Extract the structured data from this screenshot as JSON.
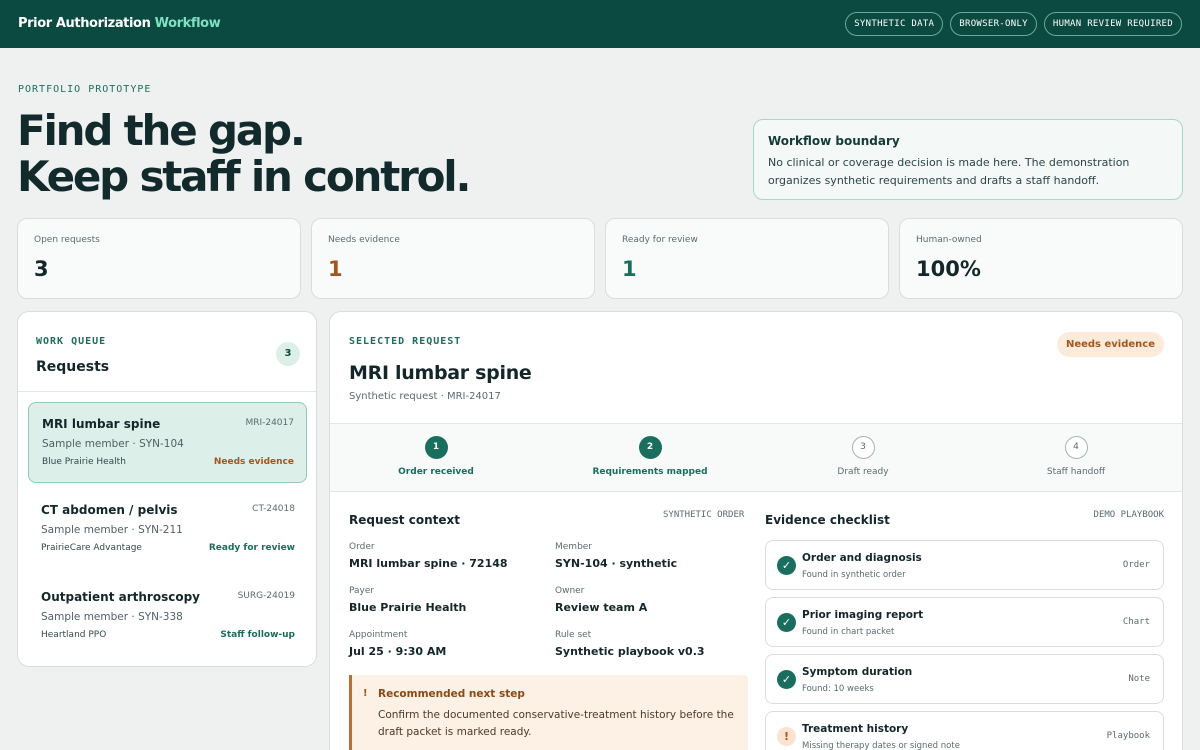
{
  "header": {
    "brand_main": "Prior Authorization",
    "brand_accent": "Workflow",
    "pills": [
      "SYNTHETIC DATA",
      "BROWSER-ONLY",
      "HUMAN REVIEW REQUIRED"
    ]
  },
  "hero": {
    "eyebrow": "PORTFOLIO PROTOTYPE",
    "title_line1": "Find the gap.",
    "title_line2": "Keep staff in control.",
    "boundary_title": "Workflow boundary",
    "boundary_body": "No clinical or coverage decision is made here. The demonstration organizes synthetic requirements and drafts a staff handoff."
  },
  "stats": [
    {
      "label": "Open requests",
      "value": "3",
      "color": "#14262a"
    },
    {
      "label": "Needs evidence",
      "value": "1",
      "color": "#a3561c"
    },
    {
      "label": "Ready for review",
      "value": "1",
      "color": "#1a6e5d"
    },
    {
      "label": "Human-owned",
      "value": "100%",
      "color": "#14262a"
    }
  ],
  "queue": {
    "eyebrow": "WORK QUEUE",
    "title": "Requests",
    "count": "3",
    "items": [
      {
        "title": "MRI lumbar spine",
        "id": "MRI-24017",
        "member": "Sample member · SYN-104",
        "payer": "Blue Prairie Health",
        "status": "Needs evidence",
        "status_color": "#a3561c",
        "active": true
      },
      {
        "title": "CT abdomen / pelvis",
        "id": "CT-24018",
        "member": "Sample member · SYN-211",
        "payer": "PrairieCare Advantage",
        "status": "Ready for review",
        "status_color": "#1a6e5d",
        "active": false
      },
      {
        "title": "Outpatient arthroscopy",
        "id": "SURG-24019",
        "member": "Sample member · SYN-338",
        "payer": "Heartland PPO",
        "status": "Staff follow-up",
        "status_color": "#1a6e5d",
        "active": false
      }
    ]
  },
  "detail": {
    "eyebrow": "SELECTED REQUEST",
    "title": "MRI lumbar spine",
    "subtitle": "Synthetic request · MRI-24017",
    "badge": "Needs evidence",
    "steps": [
      {
        "num": "1",
        "label": "Order received",
        "done": true
      },
      {
        "num": "2",
        "label": "Requirements mapped",
        "done": true
      },
      {
        "num": "3",
        "label": "Draft ready",
        "done": false
      },
      {
        "num": "4",
        "label": "Staff handoff",
        "done": false
      }
    ],
    "context": {
      "title": "Request context",
      "tag": "SYNTHETIC ORDER",
      "fields": [
        {
          "label": "Order",
          "value": "MRI lumbar spine · 72148"
        },
        {
          "label": "Member",
          "value": "SYN-104 · synthetic"
        },
        {
          "label": "Payer",
          "value": "Blue Prairie Health"
        },
        {
          "label": "Owner",
          "value": "Review team A"
        },
        {
          "label": "Appointment",
          "value": "Jul 25 · 9:30 AM"
        },
        {
          "label": "Rule set",
          "value": "Synthetic playbook v0.3"
        }
      ]
    },
    "next_step": {
      "icon": "!",
      "title": "Recommended next step",
      "body": "Confirm the documented conservative-treatment history before the draft packet is marked ready."
    },
    "evidence": {
      "title": "Evidence checklist",
      "tag": "DEMO PLAYBOOK",
      "items": [
        {
          "name": "Order and diagnosis",
          "note": "Found in synthetic order",
          "source": "Order",
          "state": "ok",
          "icon": "check-icon"
        },
        {
          "name": "Prior imaging report",
          "note": "Found in chart packet",
          "source": "Chart",
          "state": "ok",
          "icon": "check-icon"
        },
        {
          "name": "Symptom duration",
          "note": "Found: 10 weeks",
          "source": "Note",
          "state": "ok",
          "icon": "check-icon"
        },
        {
          "name": "Treatment history",
          "note": "Missing therapy dates or signed note",
          "source": "Playbook",
          "state": "warn",
          "icon": "warning-icon"
        }
      ]
    }
  }
}
